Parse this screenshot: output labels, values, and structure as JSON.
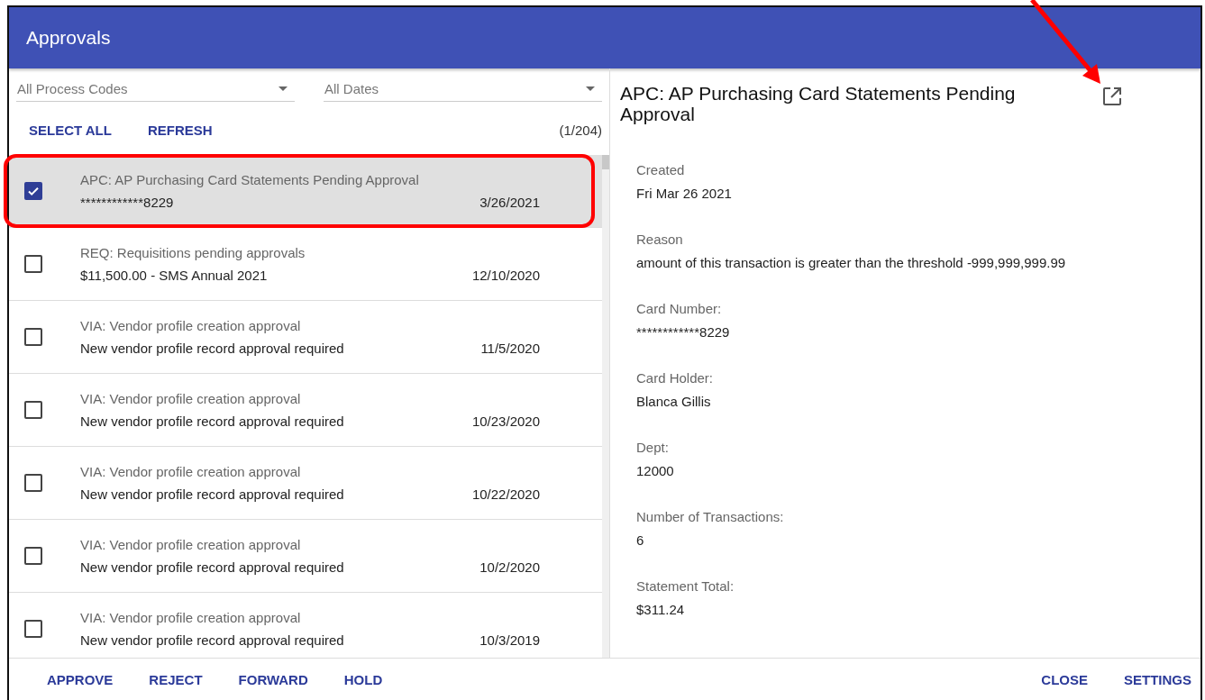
{
  "window": {
    "title": "Approvals"
  },
  "filters": [
    {
      "value": "All Process Codes"
    },
    {
      "value": "All Dates"
    }
  ],
  "list_actions": [
    "SELECT ALL",
    "REFRESH"
  ],
  "count": "(1/204)",
  "items": [
    {
      "title": "APC: AP Purchasing Card Statements Pending Approval",
      "subtitle": "************8229",
      "date": "3/26/2021",
      "checked": true,
      "selected": true
    },
    {
      "title": "REQ: Requisitions pending approvals",
      "subtitle": "$11,500.00 - SMS Annual 2021",
      "date": "12/10/2020",
      "checked": false,
      "selected": false
    },
    {
      "title": "VIA: Vendor profile creation approval",
      "subtitle": "New vendor profile record approval required",
      "date": "11/5/2020",
      "checked": false,
      "selected": false
    },
    {
      "title": "VIA: Vendor profile creation approval",
      "subtitle": "New vendor profile record approval required",
      "date": "10/23/2020",
      "checked": false,
      "selected": false
    },
    {
      "title": "VIA: Vendor profile creation approval",
      "subtitle": "New vendor profile record approval required",
      "date": "10/22/2020",
      "checked": false,
      "selected": false
    },
    {
      "title": "VIA: Vendor profile creation approval",
      "subtitle": "New vendor profile record approval required",
      "date": "10/2/2020",
      "checked": false,
      "selected": false
    },
    {
      "title": "VIA: Vendor profile creation approval",
      "subtitle": "New vendor profile record approval required",
      "date": "10/3/2019",
      "checked": false,
      "selected": false
    }
  ],
  "detail": {
    "title": "APC: AP Purchasing Card Statements Pending Approval",
    "fields": [
      {
        "label": "Created",
        "value": "Fri Mar 26 2021"
      },
      {
        "label": "Reason",
        "value": "amount of this transaction is greater than the threshold -999,999,999.99"
      },
      {
        "label": "Card Number:",
        "value": "************8229"
      },
      {
        "label": "Card Holder:",
        "value": "Blanca Gillis"
      },
      {
        "label": "Dept:",
        "value": "12000"
      },
      {
        "label": "Number of Transactions:",
        "value": "6"
      },
      {
        "label": "Statement Total:",
        "value": "$311.24"
      }
    ]
  },
  "footer": {
    "left_actions": [
      "APPROVE",
      "REJECT",
      "FORWARD",
      "HOLD"
    ],
    "right_actions": [
      "CLOSE",
      "SETTINGS"
    ]
  }
}
